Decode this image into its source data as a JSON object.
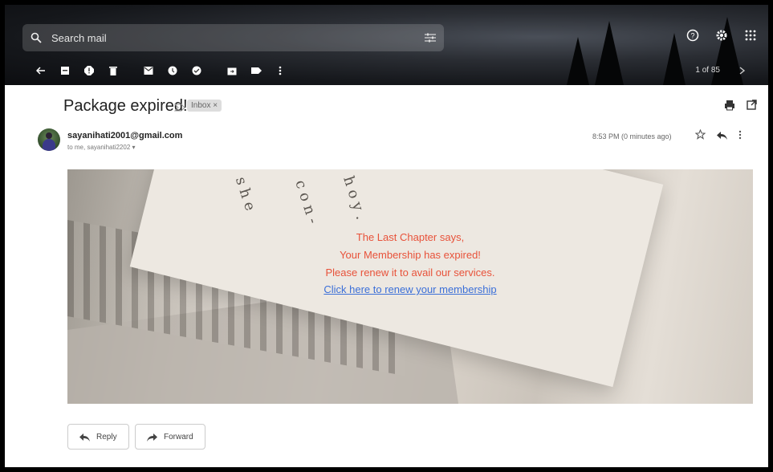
{
  "search": {
    "placeholder": "Search mail"
  },
  "toolbar": {
    "icons": [
      "back-arrow-icon",
      "archive-icon",
      "report-spam-icon",
      "delete-icon",
      "mark-unread-icon",
      "snooze-icon",
      "add-task-icon",
      "move-to-icon",
      "label-icon",
      "more-icon"
    ],
    "pager": "1 of 85"
  },
  "email": {
    "subject": "Package expired!",
    "label": "Inbox ×",
    "sender": "sayanihati2001@gmail.com",
    "recipients": "to me, sayanihati2202",
    "time": "8:53 PM (0 minutes ago)",
    "body": {
      "line1": "The Last Chapter says,",
      "line2": "Your Membership has expired!",
      "line3": "Please renew it to avail our services.",
      "link": "Click here to renew your membership"
    }
  },
  "actions": {
    "reply": "Reply",
    "forward": "Forward"
  },
  "colors": {
    "body_text": "#e8523a",
    "link": "#3b6fd8"
  }
}
